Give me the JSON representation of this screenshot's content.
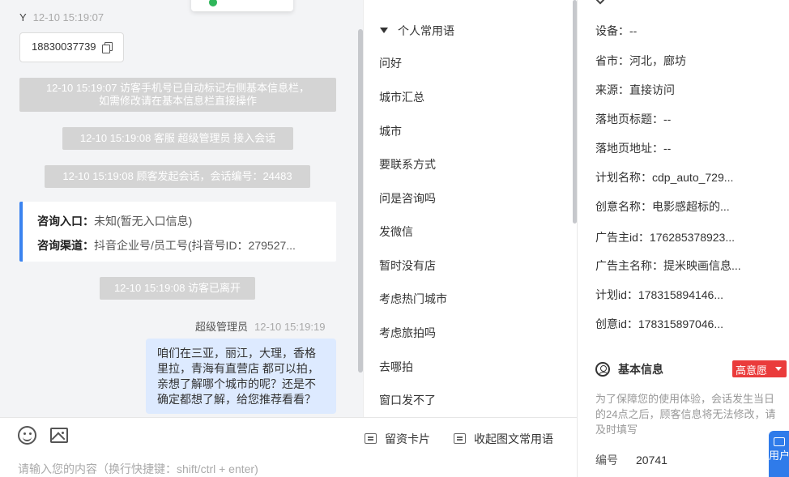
{
  "chat": {
    "visitor_name": "Y",
    "visitor_time": "12-10 15:19:07",
    "phone": "18830037739",
    "system_messages": [
      "12-10 15:19:07 访客手机号已自动标记右侧基本信息栏，",
      "如需修改请在基本信息栏直接操作",
      "12-10 15:19:08 客服 超级管理员 接入会话",
      "12-10 15:19:08 顾客发起会话，会话编号：24483",
      "12-10 15:19:08 访客已离开"
    ],
    "consult": {
      "entry_label": "咨询入口：",
      "entry_value": "未知(暂无入口信息)",
      "channel_label": "咨询渠道：",
      "channel_value": "抖音企业号/员工号(抖音号ID：279527..."
    },
    "agent_name": "超级管理员",
    "agent_time": "12-10 15:19:19",
    "agent_message": "咱们在三亚，丽江，大理，香格里拉，青海有直营店 都可以拍，亲想了解哪个城市的呢？还是不确定都想了解，给您推荐看看？"
  },
  "input_area": {
    "card_button": "留资卡片",
    "collapse_button": "收起图文常用语",
    "placeholder": "请输入您的内容（换行快捷键：shift/ctrl + enter)"
  },
  "phrases": {
    "group": "个人常用语",
    "items": [
      "问好",
      "城市汇总",
      "城市",
      "要联系方式",
      "问是咨询吗",
      "发微信",
      "暂时没有店",
      "考虑热门城市",
      "考虑旅拍吗",
      "去哪拍",
      "窗口发不了"
    ]
  },
  "info": {
    "rows": [
      {
        "label": "设备：",
        "value": "--"
      },
      {
        "label": "省市：",
        "value": "河北，廊坊"
      },
      {
        "label": "来源：",
        "value": "直接访问"
      },
      {
        "label": "落地页标题：",
        "value": "--"
      },
      {
        "label": "落地页地址：",
        "value": "--"
      },
      {
        "label": "计划名称：",
        "value": "cdp_auto_729..."
      },
      {
        "label": "创意名称：",
        "value": "电影感超标的..."
      },
      {
        "label": "广告主id：",
        "value": "176285378923..."
      },
      {
        "label": "广告主名称：",
        "value": "提米映画信息..."
      },
      {
        "label": "计划id：",
        "value": "178315894146..."
      },
      {
        "label": "创意id：",
        "value": "178315897046..."
      }
    ],
    "basic_title": "基本信息",
    "intent_badge": "高意愿",
    "notice": "为了保障您的使用体验，会话发生当日的24点之后，顾客信息将无法修改，请及时填写",
    "serial_label": "编号",
    "serial_value": "20741"
  },
  "float_tab": {
    "label": "用户"
  },
  "colors": {
    "accent": "#2f7bea",
    "badge": "#ea3b3b",
    "agent_bubble": "#ddeaff",
    "system": "#d4d4d4"
  }
}
